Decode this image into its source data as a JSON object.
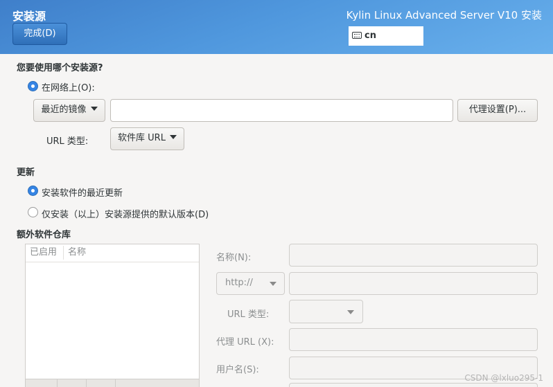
{
  "header": {
    "spoke_title": "安装源",
    "done_button": "完成(D)",
    "product_title": "Kylin Linux Advanced Server V10 安装",
    "keyboard_layout": "cn",
    "accent_color": "#4a90d9"
  },
  "source": {
    "question": "您要使用哪个安装源?",
    "network_radio": "在网络上(O):",
    "network_selected": true,
    "mirror_dropdown": "最近的镜像",
    "url_value": "",
    "proxy_button": "代理设置(P)...",
    "url_type_label": "URL 类型:",
    "url_type_value": "软件库 URL"
  },
  "updates": {
    "heading": "更新",
    "option_latest": "安装软件的最近更新",
    "option_latest_selected": true,
    "option_default": "仅安装（以上）安装源提供的默认版本(D)",
    "option_default_selected": false
  },
  "extra_repos": {
    "heading": "额外软件仓库",
    "columns": [
      "已启用",
      "名称"
    ],
    "name_label": "名称(N):",
    "protocol_value": "http://",
    "url_type_label": "URL 类型:",
    "proxy_url_label": "代理 URL (X):",
    "username_label": "用户名(S):"
  },
  "watermark": "CSDN @lxluo295-1"
}
